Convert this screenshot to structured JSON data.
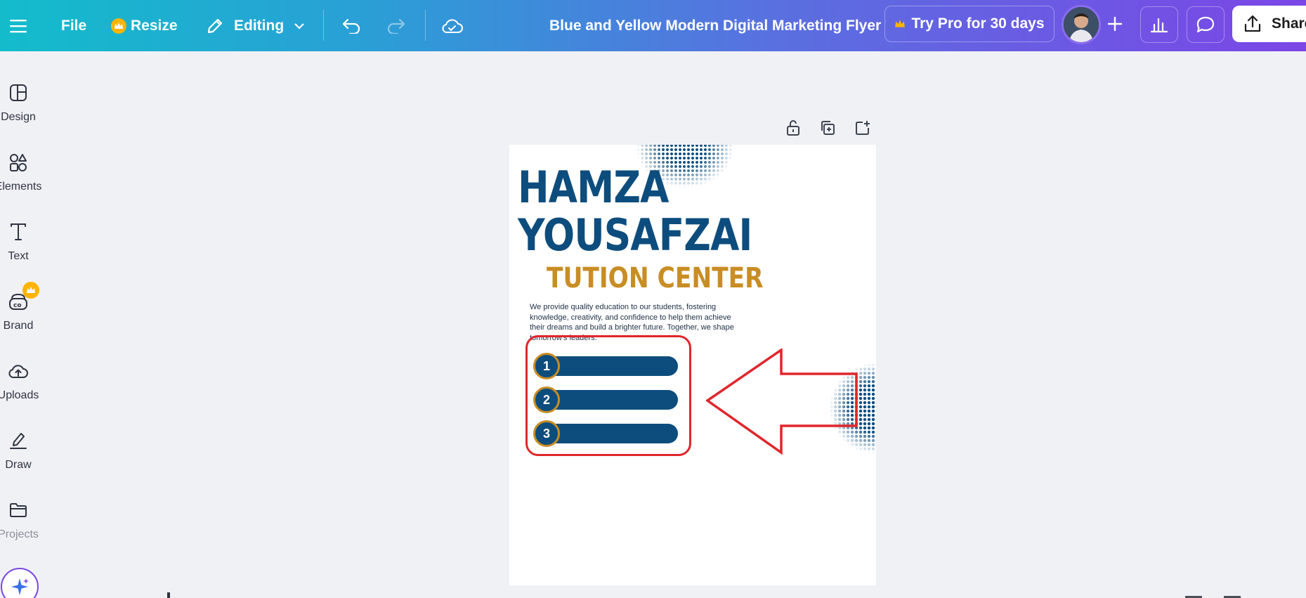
{
  "topbar": {
    "file_label": "File",
    "resize_label": "Resize",
    "editing_label": "Editing",
    "doc_title": "Blue and Yellow Modern Digital Marketing Flyer",
    "try_pro_label": "Try Pro for 30 days",
    "share_label": "Share"
  },
  "sidebar": {
    "items": [
      {
        "label": "Design"
      },
      {
        "label": "Elements"
      },
      {
        "label": "Text"
      },
      {
        "label": "Brand"
      },
      {
        "label": "Uploads"
      },
      {
        "label": "Draw"
      },
      {
        "label": "Projects"
      }
    ]
  },
  "flyer": {
    "title_line1": "HAMZA",
    "title_line2": "YOUSAFZAI",
    "subtitle": "TUTION CENTER",
    "description": "We provide quality education to our students, fostering knowledge, creativity, and confidence to help them achieve their dreams and build a brighter future. Together, we shape tomorrow's leaders.",
    "list_numbers": [
      "1",
      "2",
      "3"
    ]
  },
  "colors": {
    "brand_blue": "#0d4d7d",
    "brand_gold": "#c88d24",
    "highlight_red": "#e0262b"
  }
}
